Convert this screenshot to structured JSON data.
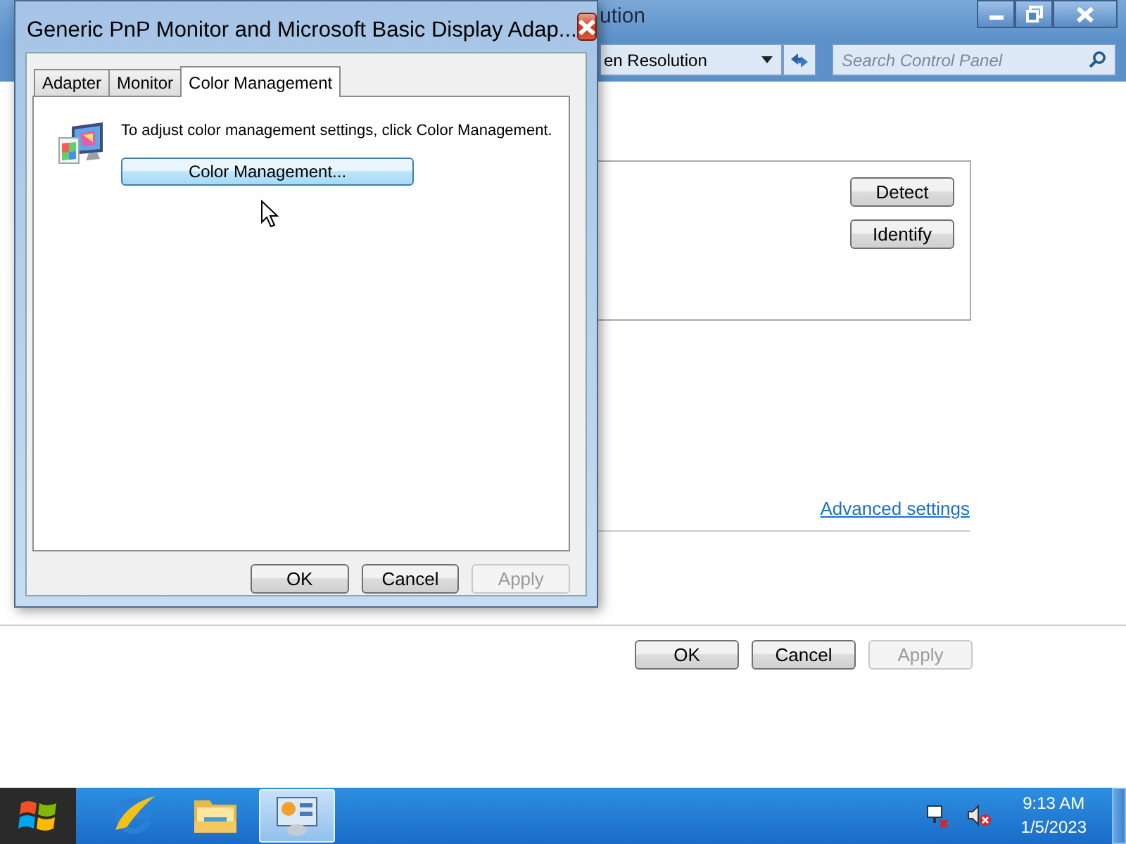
{
  "background_window": {
    "title": "ution",
    "address_bar": {
      "text": "en Resolution"
    },
    "search": {
      "placeholder": "Search Control Panel"
    },
    "display_buttons": [
      {
        "label": "Detect"
      },
      {
        "label": "Identify"
      }
    ],
    "link": "Advanced settings",
    "buttons": [
      {
        "label": "OK",
        "disabled": false
      },
      {
        "label": "Cancel",
        "disabled": false
      },
      {
        "label": "Apply",
        "disabled": true
      }
    ]
  },
  "dialog": {
    "title": "Generic PnP Monitor and Microsoft Basic Display Adap...",
    "tabs": [
      {
        "label": "Adapter",
        "selected": false
      },
      {
        "label": "Monitor",
        "selected": false
      },
      {
        "label": "Color Management",
        "selected": true
      }
    ],
    "description": "To adjust color management settings, click Color Management.",
    "action_button": "Color Management...",
    "buttons": [
      {
        "label": "OK",
        "disabled": false
      },
      {
        "label": "Cancel",
        "disabled": false
      },
      {
        "label": "Apply",
        "disabled": true
      }
    ]
  },
  "taskbar": {
    "items": [
      {
        "kind": "start",
        "selected": false
      },
      {
        "kind": "browser",
        "selected": false
      },
      {
        "kind": "folder",
        "selected": false
      },
      {
        "kind": "control-panel",
        "selected": true
      }
    ],
    "clock": {
      "time": "9:13 AM",
      "date": "1/5/2023"
    }
  }
}
